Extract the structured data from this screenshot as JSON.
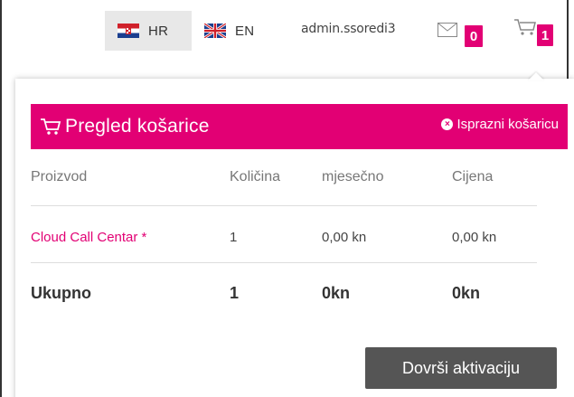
{
  "topbar": {
    "languages": [
      {
        "code": "HR",
        "flag_icon": "croatia-flag-icon",
        "selected": true
      },
      {
        "code": "EN",
        "flag_icon": "uk-flag-icon",
        "selected": false
      }
    ],
    "username": "admin.ssoredi3",
    "messages_count": "0",
    "cart_count": "1"
  },
  "cart": {
    "title": "Pregled košarice",
    "empty_label": "Isprazni košaricu",
    "columns": [
      "Proizvod",
      "Količina",
      "mjesečno",
      "Cijena"
    ],
    "items": [
      {
        "product": "Cloud Call Centar *",
        "quantity": "1",
        "monthly": "0,00 kn",
        "price": "0,00 kn"
      }
    ],
    "total": {
      "label": "Ukupno",
      "quantity": "1",
      "monthly": "0kn",
      "price": "0kn"
    },
    "finish_button": "Dovrši aktivaciju"
  },
  "colors": {
    "accent": "#e20074",
    "button": "#555555"
  }
}
